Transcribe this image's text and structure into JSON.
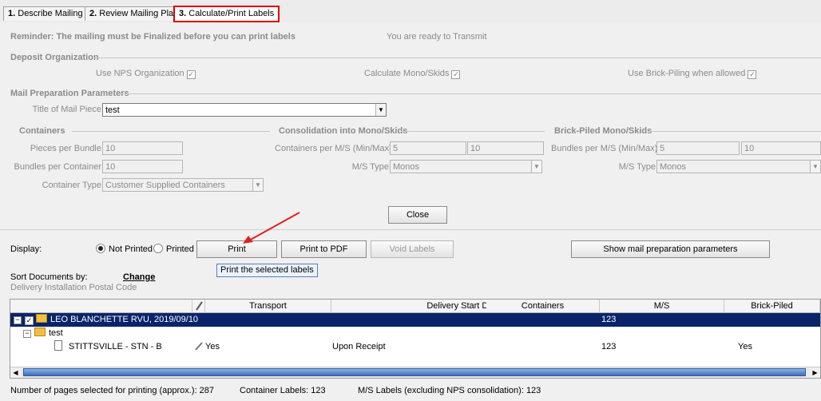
{
  "tabs": [
    {
      "num": "1.",
      "label": "Describe Mailing"
    },
    {
      "num": "2.",
      "label": "Review Mailing Plan"
    },
    {
      "num": "3.",
      "label": "Calculate/Print Labels"
    }
  ],
  "reminder": "Reminder: The mailing must be Finalized before you can print labels",
  "ready": "You are ready to Transmit",
  "deposit": {
    "title": "Deposit Organization",
    "use_nps": "Use NPS Organization",
    "calc_mono": "Calculate Mono/Skids",
    "brick": "Use Brick-Piling when allowed"
  },
  "mailprep": {
    "title": "Mail Preparation Parameters",
    "title_label": "Title of Mail Piece",
    "title_value": "test"
  },
  "containers": {
    "title": "Containers",
    "pieces_label": "Pieces per Bundle",
    "pieces_value": "10",
    "bundles_label": "Bundles per Container",
    "bundles_value": "10",
    "type_label": "Container Type",
    "type_value": "Customer Supplied Containers"
  },
  "consolidation": {
    "title": "Consolidation into Mono/Skids",
    "cpm_label": "Containers per M/S (Min/Max)",
    "min": "5",
    "max": "10",
    "mstype_label": "M/S Type",
    "mstype_value": "Monos"
  },
  "brickpiled": {
    "title": "Brick-Piled Mono/Skids",
    "bpm_label": "Bundles per M/S (Min/Max)",
    "min": "5",
    "max": "10",
    "mstype_label": "M/S Type",
    "mstype_value": "Monos"
  },
  "buttons": {
    "close": "Close",
    "print": "Print",
    "print_pdf": "Print to PDF",
    "void": "Void Labels",
    "show_params": "Show mail preparation parameters"
  },
  "display": {
    "label": "Display:",
    "not_printed": "Not Printed",
    "printed": "Printed"
  },
  "tooltip": "Print the selected labels",
  "sort": {
    "label": "Sort Documents by:",
    "change": "Change",
    "value": "Delivery Installation Postal Code"
  },
  "grid": {
    "headers": [
      "Transport",
      "Delivery Start Date",
      "Containers",
      "M/S",
      "Brick-Piled"
    ],
    "rows": [
      {
        "name": "LEO BLANCHETTE RVU, 2019/09/10",
        "ms": "123"
      },
      {
        "name": "test"
      },
      {
        "name": "STITTSVILLE - STN - B",
        "transport": "Yes",
        "start": "Upon Receipt",
        "ms": "123",
        "brick": "Yes"
      }
    ]
  },
  "footer": {
    "pages": "Number of pages selected for printing (approx.): 287",
    "container_labels": "Container Labels: 123",
    "ms_labels": "M/S Labels (excluding NPS consolidation): 123"
  },
  "colors": {
    "active_tab_border": "#e00000",
    "selected_row": "#0a246a",
    "arrow": "#e02020"
  }
}
